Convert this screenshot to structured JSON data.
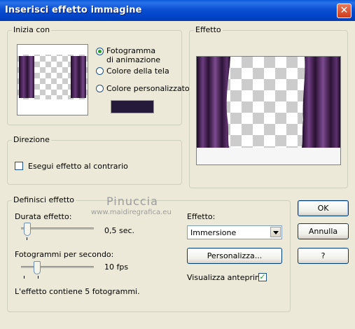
{
  "window": {
    "title": "Inserisci effetto immagine"
  },
  "start": {
    "legend": "Inizia con",
    "options": [
      "Fotogramma\ndi animazione",
      "Colore della tela",
      "Colore personalizzato"
    ],
    "option_lines": [
      [
        "Fotogramma",
        "di animazione"
      ],
      [
        "Colore della tela"
      ],
      [
        "Colore personalizzato"
      ]
    ],
    "selected": 0,
    "custom_color": "#261a3a"
  },
  "preview": {
    "legend": "Effetto"
  },
  "direction": {
    "legend": "Direzione",
    "reverse_label": "Esegui effetto al contrario",
    "reverse_checked": false
  },
  "define": {
    "legend": "Definisci effetto",
    "duration_label": "Durata effetto:",
    "duration_value": "0,5 sec.",
    "fps_label": "Fotogrammi per secondo:",
    "fps_value": "10 fps",
    "info": "L'effetto contiene 5 fotogrammi.",
    "effect_label": "Effetto:",
    "effect_selected": "Immersione",
    "customize_label": "Personalizza...",
    "preview_label": "Visualizza anteprima",
    "preview_checked": true
  },
  "buttons": {
    "ok": "OK",
    "cancel": "Annulla",
    "help": "?"
  },
  "watermark": {
    "name": "Pinuccia",
    "site": "www.maidiregrafica.eu"
  },
  "colors": {
    "accent": "#0a5ad8",
    "curtain": "#3e1f4d"
  }
}
